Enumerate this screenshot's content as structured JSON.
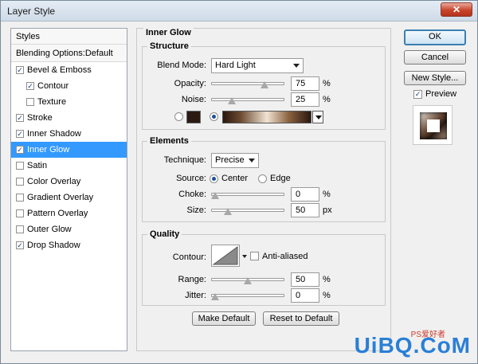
{
  "window": {
    "title": "Layer Style",
    "close_glyph": "✕"
  },
  "styles": {
    "header": "Styles",
    "blending": "Blending Options:Default",
    "items": [
      {
        "label": "Bevel & Emboss",
        "checked": true,
        "sub": false
      },
      {
        "label": "Contour",
        "checked": true,
        "sub": true
      },
      {
        "label": "Texture",
        "checked": false,
        "sub": true
      },
      {
        "label": "Stroke",
        "checked": true,
        "sub": false
      },
      {
        "label": "Inner Shadow",
        "checked": true,
        "sub": false
      },
      {
        "label": "Inner Glow",
        "checked": true,
        "sub": false,
        "selected": true
      },
      {
        "label": "Satin",
        "checked": false,
        "sub": false
      },
      {
        "label": "Color Overlay",
        "checked": false,
        "sub": false
      },
      {
        "label": "Gradient Overlay",
        "checked": false,
        "sub": false
      },
      {
        "label": "Pattern Overlay",
        "checked": false,
        "sub": false
      },
      {
        "label": "Outer Glow",
        "checked": false,
        "sub": false
      },
      {
        "label": "Drop Shadow",
        "checked": true,
        "sub": false
      }
    ]
  },
  "inner_glow": {
    "title": "Inner Glow",
    "structure": {
      "title": "Structure",
      "blend_mode_label": "Blend Mode:",
      "blend_mode_value": "Hard Light",
      "opacity_label": "Opacity:",
      "opacity_value": "75",
      "opacity_fraction": 0.75,
      "noise_label": "Noise:",
      "noise_value": "25",
      "noise_fraction": 0.25,
      "unit": "%",
      "color_swatch": "#2b1a12"
    },
    "elements": {
      "title": "Elements",
      "technique_label": "Technique:",
      "technique_value": "Precise",
      "source_label": "Source:",
      "source_center": "Center",
      "source_edge": "Edge",
      "choke_label": "Choke:",
      "choke_value": "0",
      "choke_fraction": 0,
      "size_label": "Size:",
      "size_value": "50",
      "size_fraction": 0.2,
      "percent_unit": "%",
      "px_unit": "px"
    },
    "quality": {
      "title": "Quality",
      "contour_label": "Contour:",
      "anti_aliased_label": "Anti-aliased",
      "anti_aliased_checked": false,
      "range_label": "Range:",
      "range_value": "50",
      "range_fraction": 0.5,
      "jitter_label": "Jitter:",
      "jitter_value": "0",
      "jitter_fraction": 0,
      "unit": "%"
    },
    "make_default": "Make Default",
    "reset_default": "Reset to Default"
  },
  "buttons": {
    "ok": "OK",
    "cancel": "Cancel",
    "new_style": "New Style...",
    "preview_label": "Preview",
    "preview_checked": true
  },
  "watermark": {
    "main": "UiBQ.CoM",
    "small": "PS爱好者"
  }
}
